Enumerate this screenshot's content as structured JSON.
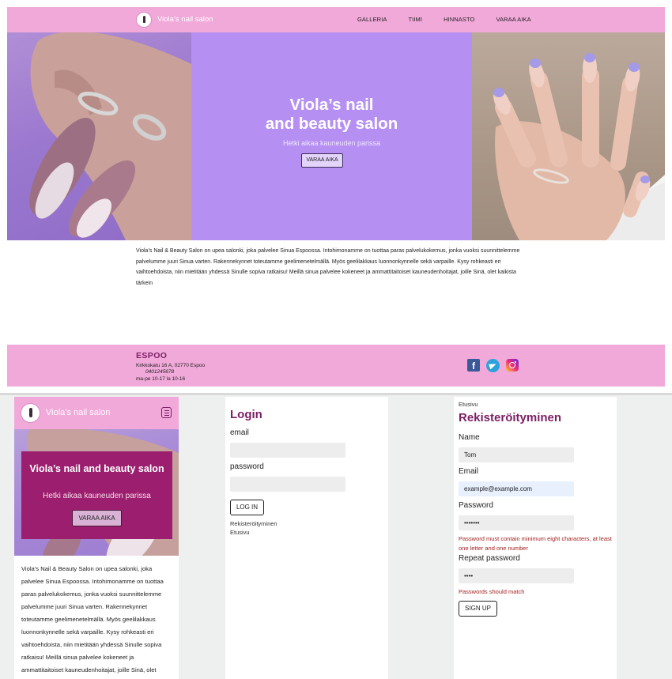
{
  "desktop": {
    "brand": "Viola’s nail salon",
    "nav": [
      "GALLERIA",
      "TIIMI",
      "HINNASTO",
      "VARAA AIKA"
    ],
    "hero": {
      "title_line1": "Viola’s nail",
      "title_line2": "and beauty salon",
      "subtitle": "Hetki aikaa kauneuden parissa",
      "button": "VARAA AIKA"
    },
    "intro": "Viola’s Nail & Beauty Salon on upea salonki, joka palvelee Sinua Espoossa. Intohimonamme on tuottaa paras palvelukokemus, jonka vuoksi suunnittelemme palvelumme juuri Sinua varten. Rakennekynnet toteutamme geelimenetelmällä. Myös geelilakkaus luonnonkynnelle sekä varpaille. Kysy rohkeasti eri vaihtoehdoista, niin mietitään yhdessä Sinulle sopiva ratkaisu! Meillä sinua palvelee kokeneet ja ammattitaitoiset kauneudenhoitajat, joille Sinä, olet kaikista tärkein",
    "footer": {
      "city": "ESPOO",
      "address": "Kirkkokatu 16 A, 02770 Espoo",
      "phone": "0401245678",
      "hours": "ma-pe 10-17 la 10-16",
      "social": [
        "facebook-icon",
        "telegram-icon",
        "instagram-icon"
      ]
    }
  },
  "mobile": {
    "brand": "Viola’s nail salon",
    "hero": {
      "title": "Viola’s nail and beauty salon",
      "subtitle": "Hetki aikaa kauneuden parissa",
      "button": "VARAA AIKA"
    },
    "intro": "Viola’s Nail & Beauty Salon on upea salonki, joka palvelee Sinua Espoossa. Intohimonamme on tuottaa paras palvelukokemus, jonka vuoksi suunnittelemme palvelumme juuri Sinua varten. Rakennekynnet toteutamme geelimenetelmällä. Myös geelilakkaus luonnonkynnelle sekä varpaille. Kysy rohkeasti eri vaihtoehdoista, niin mietitään yhdessä Sinulle sopiva ratkaisu! Meillä sinua palvelee kokeneet ja ammattitaitoiset kauneudenhoitajat, joille Sinä, olet kaikista tärkein"
  },
  "login": {
    "title": "Login",
    "email_label": "email",
    "password_label": "password",
    "button": "LOG IN",
    "link_register": "Rekisteröityminen",
    "link_home": "Etusivu"
  },
  "register": {
    "breadcrumb": "Etusivu",
    "title": "Rekisteröityminen",
    "name_label": "Name",
    "name_value": "Tom",
    "email_label": "Email",
    "email_value": "example@example.com",
    "password_label": "Password",
    "password_value": "•••••••",
    "password_error": "Password must contain minimum eight characters, at least one letter and one number",
    "repeat_label": "Repeat password",
    "repeat_value": "••••",
    "repeat_error": "Passwords should match",
    "button": "SIGN UP"
  },
  "colors": {
    "pink": "#f1a9da",
    "violet": "#b590f2",
    "plum": "#7b1f64",
    "magenta_card": "#9b1f6e",
    "error": "#a01e1e"
  }
}
